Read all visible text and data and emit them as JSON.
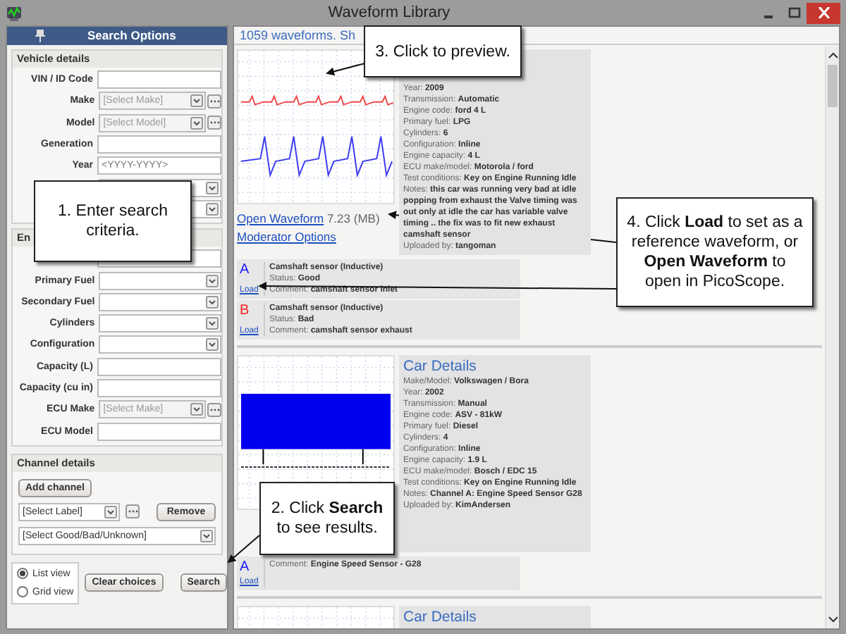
{
  "window": {
    "title": "Waveform Library"
  },
  "search_panel": {
    "title": "Search Options",
    "groups": [
      {
        "title": "Vehicle details",
        "fields": [
          {
            "label": "VIN / ID Code",
            "kind": "text"
          },
          {
            "label": "Make",
            "kind": "select_more",
            "placeholder": "[Select Make]"
          },
          {
            "label": "Model",
            "kind": "select_more",
            "placeholder": "[Select Model]"
          },
          {
            "label": "Generation",
            "kind": "text"
          },
          {
            "label": "Year",
            "kind": "text",
            "placeholder": "<YYYY-YYYY>"
          },
          {
            "kind": "select"
          },
          {
            "kind": "select"
          }
        ]
      },
      {
        "title": "En",
        "fields": [
          {
            "kind": "text"
          },
          {
            "label": "Primary Fuel",
            "kind": "select"
          },
          {
            "label": "Secondary Fuel",
            "kind": "select"
          },
          {
            "label": "Cylinders",
            "kind": "select"
          },
          {
            "label": "Configuration",
            "kind": "select"
          },
          {
            "label": "Capacity (L)",
            "kind": "text"
          },
          {
            "label": "Capacity (cu in)",
            "kind": "text"
          },
          {
            "label": "ECU Make",
            "kind": "select_more",
            "placeholder": "[Select Make]"
          },
          {
            "label": "ECU Model",
            "kind": "text"
          }
        ]
      }
    ],
    "channel_details": {
      "title": "Channel details",
      "add_button": "Add channel",
      "label_select": "[Select Label]",
      "remove_button": "Remove",
      "status_select": "[Select Good/Bad/Unknown]"
    },
    "view_options": [
      {
        "label": "List view",
        "selected": true
      },
      {
        "label": "Grid view",
        "selected": false
      }
    ],
    "clear_button": "Clear choices",
    "search_button": "Search"
  },
  "results": {
    "summary": "1059 waveforms. Sh",
    "cards": [
      {
        "kind": "two_traces",
        "details": [
          {
            "label": "Year:",
            "value": "2009"
          },
          {
            "label": "Transmission:",
            "value": "Automatic"
          },
          {
            "label": "Engine code:",
            "value": "ford 4 L"
          },
          {
            "label": "Primary fuel:",
            "value": "LPG"
          },
          {
            "label": "Cylinders:",
            "value": "6"
          },
          {
            "label": "Configuration:",
            "value": "Inline"
          },
          {
            "label": "Engine capacity:",
            "value": "4 L"
          },
          {
            "label": "ECU make/model:",
            "value": "Motorola / ford"
          },
          {
            "label": "Test conditions:",
            "value": "Key on Engine Running Idle"
          },
          {
            "label": "Notes:",
            "value": "this car was running very bad at idle popping from exhaust the Valve timing was out only at idle the car has variable valve timing .. the fix was to fit new exhaust camshaft sensor"
          },
          {
            "label": "Uploaded by:",
            "value": "tangoman"
          }
        ],
        "open_link": "Open Waveform",
        "size": "7.23 (MB)",
        "moderator_link": "Moderator Options",
        "channels": [
          {
            "letter": "A",
            "color": "#1a1aff",
            "load": "Load",
            "lines": [
              {
                "value": "Camshaft sensor (Inductive)"
              },
              {
                "label": "Status:",
                "value": "Good"
              },
              {
                "label": "Comment:",
                "value": "camshaft sensor inlet"
              }
            ]
          },
          {
            "letter": "B",
            "color": "#ff2020",
            "load": "Load",
            "lines": [
              {
                "value": "Camshaft sensor (Inductive)"
              },
              {
                "label": "Status:",
                "value": "Bad"
              },
              {
                "label": "Comment:",
                "value": "camshaft sensor exhaust"
              }
            ]
          }
        ]
      },
      {
        "kind": "dense_block",
        "heading": "Car Details",
        "details": [
          {
            "label": "Make/Model:",
            "value": "Volkswagen / Bora"
          },
          {
            "label": "Year:",
            "value": "2002"
          },
          {
            "label": "Transmission:",
            "value": "Manual"
          },
          {
            "label": "Engine code:",
            "value": "ASV - 81kW"
          },
          {
            "label": "Primary fuel:",
            "value": "Diesel"
          },
          {
            "label": "Cylinders:",
            "value": "4"
          },
          {
            "label": "Configuration:",
            "value": "Inline"
          },
          {
            "label": "Engine capacity:",
            "value": "1.9 L"
          },
          {
            "label": "ECU make/model:",
            "value": "Bosch / EDC 15"
          },
          {
            "label": "Test conditions:",
            "value": "Key on Engine Running Idle"
          },
          {
            "label": "Notes:",
            "value": "Channel A: Engine Speed Sensor G28"
          },
          {
            "label": "Uploaded by:",
            "value": "KimAndersen"
          }
        ],
        "channels": [
          {
            "letter": "A",
            "color": "#1a1aff",
            "load": "Load",
            "lines": [
              {
                "label": "Comment:",
                "value": "Engine Speed Sensor - G28"
              }
            ]
          }
        ]
      },
      {
        "kind": "blank_grid",
        "heading": "Car Details"
      }
    ]
  },
  "callouts": [
    {
      "text": "1. Enter search criteria."
    },
    {
      "text": "2. Click **Search** to see results."
    },
    {
      "text": "3. Click to preview."
    },
    {
      "text": "4. Click **Load** to set as a reference waveform, or **Open Waveform** to open in PicoScope."
    }
  ]
}
